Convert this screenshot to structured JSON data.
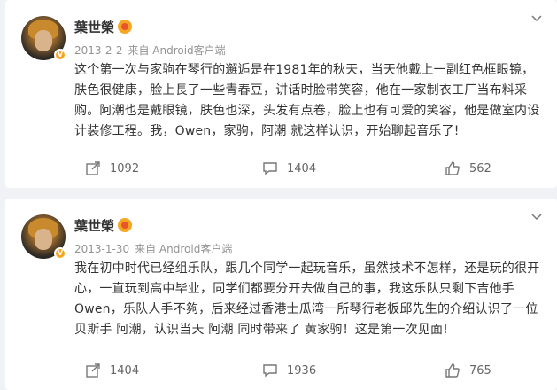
{
  "posts": [
    {
      "author": "葉世榮",
      "date": "2013-2-2",
      "source": "来自 Android客户端",
      "text": "这个第一次与家驹在琴行的邂逅是在1981年的秋天，当天他戴上一副红色框眼镜，肤色很健康，脸上長了一些青春豆，讲话时脸带笑容，他在一家制衣工厂当布料采购。阿潮也是戴眼镜，肤色也深，头发有点卷，脸上也有可爱的笑容，他是做室内设计装修工程。我，Owen，家驹，阿潮 就这样认识，开始聊起音乐了!",
      "reposts": "1092",
      "comments": "1404",
      "likes": "562"
    },
    {
      "author": "葉世榮",
      "date": "2013-1-30",
      "source": "来自 Android客户端",
      "text": "我在初中时代已经组乐队，跟几个同学一起玩音乐，虽然技术不怎样，还是玩的很开心，一直玩到高中毕业，同学们都要分开去做自己的事，我这乐队只剩下吉他手Owen，乐队人手不夠，后来经过香港士瓜湾一所琴行老板邱先生的介绍认识了一位贝斯手 阿潮，认识当天 阿潮 同时带来了 黄家驹！这是第一次见面!",
      "reposts": "1404",
      "comments": "1936",
      "likes": "765"
    }
  ],
  "icons": {
    "verified": "v-badge-icon",
    "gold": "gold-member-icon",
    "menu": "chevron-down-icon",
    "repost": "repost-icon",
    "comment": "comment-icon",
    "like": "like-icon"
  },
  "colors": {
    "verified": "#f7a51c",
    "accent": "#f5a623",
    "meta": "#939393"
  },
  "badge": "V"
}
